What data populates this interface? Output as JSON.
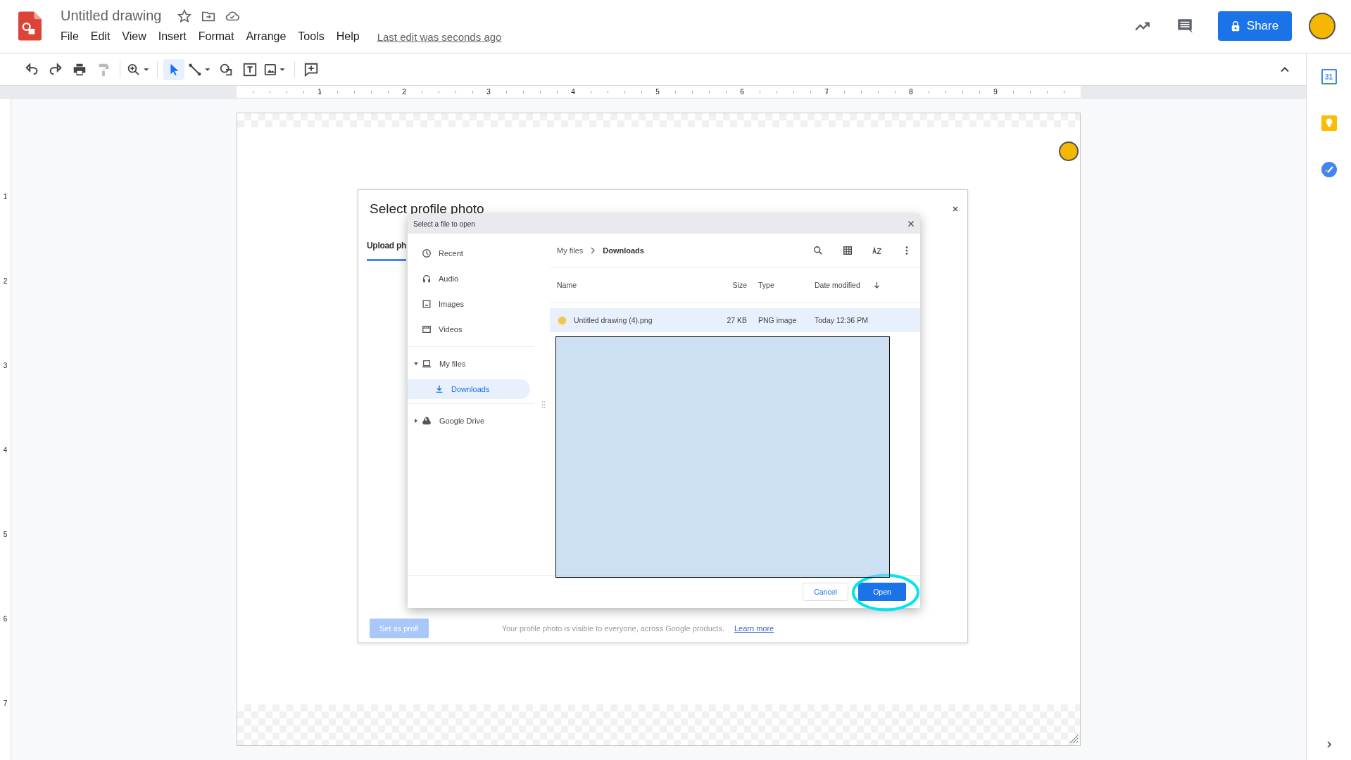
{
  "app": {
    "title": "Untitled drawing",
    "menu": [
      "File",
      "Edit",
      "View",
      "Insert",
      "Format",
      "Arrange",
      "Tools",
      "Help"
    ],
    "last_edit": "Last edit was seconds ago",
    "share": "Share"
  },
  "tool_groups": [
    [
      {
        "kind": "undo",
        "selected": false
      },
      {
        "kind": "redo",
        "selected": false
      },
      {
        "kind": "print",
        "selected": false
      },
      {
        "kind": "paint",
        "selected": false
      }
    ],
    [
      {
        "kind": "zoom",
        "selected": false
      }
    ],
    [
      {
        "kind": "select",
        "selected": true
      },
      {
        "kind": "line",
        "selected": false
      },
      {
        "kind": "shape",
        "selected": false
      },
      {
        "kind": "textbox",
        "selected": false
      },
      {
        "kind": "image",
        "selected": false
      }
    ],
    [
      {
        "kind": "comment",
        "selected": false
      }
    ]
  ],
  "ruler": {
    "horizontal": [
      "1",
      "2",
      "3",
      "4",
      "5",
      "6",
      "7",
      "8",
      "9"
    ],
    "vertical": [
      "1",
      "2",
      "3",
      "4",
      "5",
      "6",
      "7"
    ]
  },
  "side_panel": {
    "calendar_day": "31"
  },
  "dialog": {
    "title": "Select profile photo",
    "tab": "Upload ph",
    "primary": "Set as profi",
    "note": "Your profile photo is visible to everyone, across Google products.",
    "link": "Learn more"
  },
  "file_picker": {
    "title": "Select a file to open",
    "places": [
      {
        "label": "Recent",
        "kind": "recent"
      },
      {
        "label": "Audio",
        "kind": "audio"
      },
      {
        "label": "Images",
        "kind": "images"
      },
      {
        "label": "Videos",
        "kind": "videos"
      }
    ],
    "roots": [
      {
        "label": "My files",
        "kind": "computer",
        "expanded": true,
        "children": [
          {
            "label": "Downloads",
            "kind": "download",
            "selected": true
          }
        ]
      },
      {
        "label": "Google Drive",
        "kind": "drive",
        "expanded": false
      }
    ],
    "breadcrumb": [
      "My files",
      "Downloads"
    ],
    "columns": [
      "Name",
      "Size",
      "Type",
      "Date modified"
    ],
    "rows": [
      {
        "name": "Untitled drawing (4).png",
        "size": "27 KB",
        "type": "PNG image",
        "modified": "Today 12:36 PM",
        "selected": true
      }
    ],
    "buttons": [
      "Cancel",
      "Open"
    ]
  }
}
